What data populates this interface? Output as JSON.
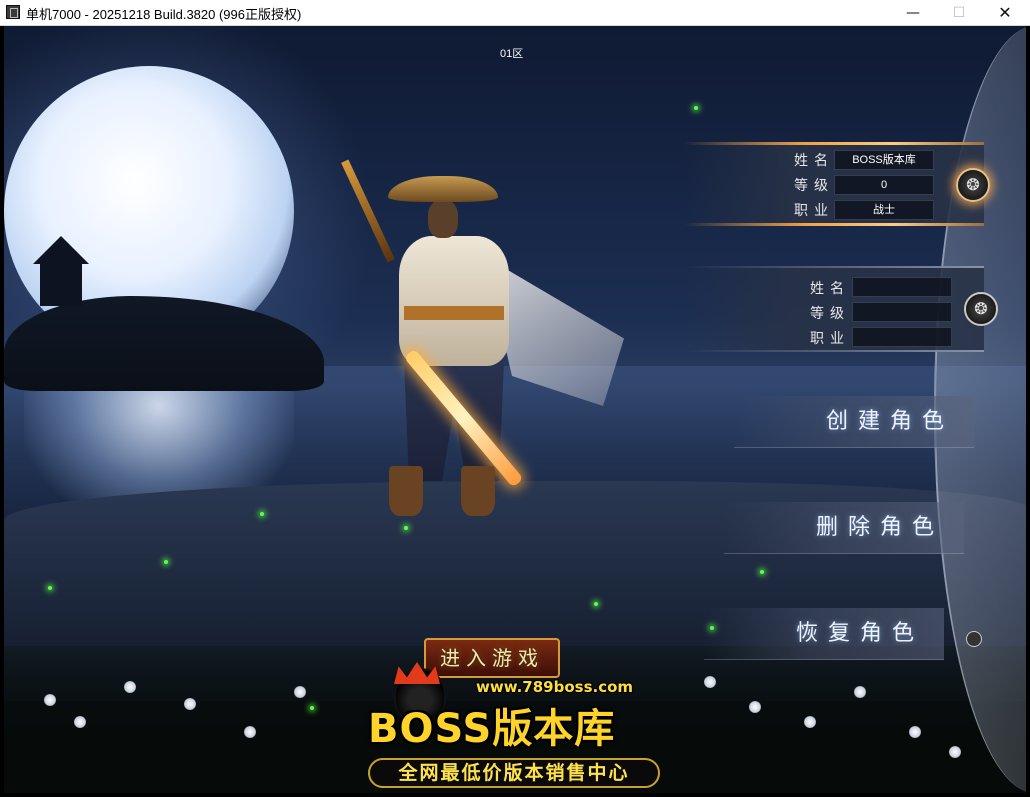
{
  "window": {
    "title": "单机7000 - 20251218 Build.3820 (996正版授权)",
    "minimize": "—",
    "maximize": "☐",
    "close": "✕"
  },
  "zone": "01区",
  "slots": [
    {
      "labels": {
        "name": "姓名",
        "level": "等级",
        "class": "职业"
      },
      "values": {
        "name": "BOSS版本库",
        "level": "0",
        "class": "战士"
      },
      "emblem": "❂",
      "selected": true
    },
    {
      "labels": {
        "name": "姓名",
        "level": "等级",
        "class": "职业"
      },
      "values": {
        "name": "",
        "level": "",
        "class": ""
      },
      "emblem": "❂",
      "selected": false
    }
  ],
  "menu": {
    "create": "创建角色",
    "delete": "删除角色",
    "restore": "恢复角色"
  },
  "enter_game": "进入游戏",
  "watermark": {
    "url": "www.789boss.com",
    "brand": "BOSS版本库",
    "slogan": "全网最低价版本销售中心"
  },
  "colors": {
    "gold_accent": "#f0a048",
    "watermark_yellow": "#ffd42a",
    "firefly_green": "#5cff4c"
  }
}
